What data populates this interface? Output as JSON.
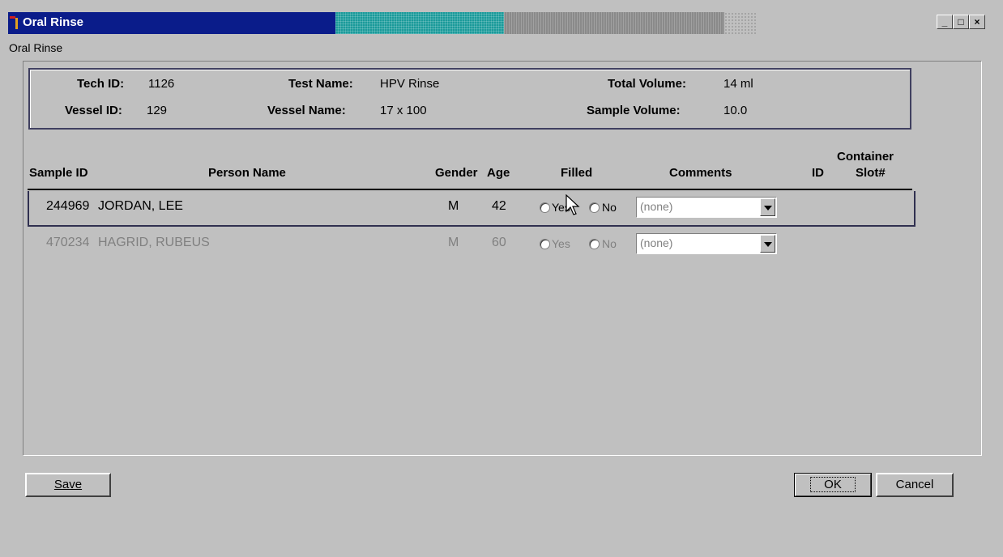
{
  "window": {
    "title": "Oral Rinse",
    "menu_label": "Oral Rinse"
  },
  "info": {
    "tech_id_label": "Tech ID:",
    "tech_id": "1126",
    "vessel_id_label": "Vessel ID:",
    "vessel_id": "129",
    "test_name_label": "Test Name:",
    "test_name": "HPV Rinse",
    "vessel_name_label": "Vessel Name:",
    "vessel_name": "17 x 100",
    "total_volume_label": "Total Volume:",
    "total_volume": "14 ml",
    "sample_volume_label": "Sample Volume:",
    "sample_volume": "10.0"
  },
  "columns": {
    "sample_id": "Sample ID",
    "person_name": "Person Name",
    "gender": "Gender",
    "age": "Age",
    "filled": "Filled",
    "comments": "Comments",
    "container": "Container",
    "id": "ID",
    "slot": "Slot#"
  },
  "rows": [
    {
      "sample_id": "244969",
      "name": "JORDAN, LEE",
      "gender": "M",
      "age": "42",
      "yes": "Yes",
      "no": "No",
      "comment": "(none)"
    },
    {
      "sample_id": "470234",
      "name": "HAGRID, RUBEUS",
      "gender": "M",
      "age": "60",
      "yes": "Yes",
      "no": "No",
      "comment": "(none)"
    }
  ],
  "buttons": {
    "save": "Save",
    "ok": "OK",
    "cancel": "Cancel"
  }
}
